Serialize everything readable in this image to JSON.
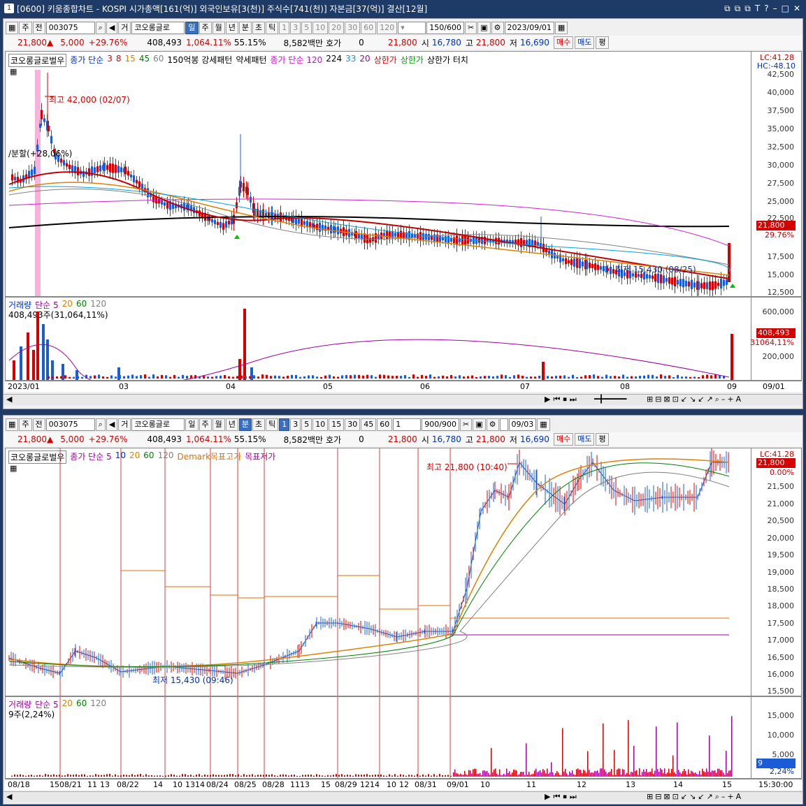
{
  "title": {
    "num": "1",
    "text": "[0600] 키움종합차트 - KOSPI 시가총액[161(억)] 외국인보유[3(천)] 주식수[741(천)] 자본금[37(억)] 결산[12월]",
    "ctrls": [
      "⧉",
      "⧉",
      "⧉",
      "T",
      "?",
      "–",
      "□",
      "✕"
    ]
  },
  "top": {
    "toolbar": {
      "kind": "주",
      "whole": "전",
      "code": "003075",
      "trade": "거",
      "name": "코오롱글로",
      "periods": [
        "일",
        "주",
        "월",
        "년",
        "분",
        "초",
        "틱"
      ],
      "nums": [
        "1",
        "3",
        "5",
        "10",
        "20",
        "30",
        "60",
        "120"
      ],
      "count": "150",
      "countmax": "/600",
      "date": "2023/09/01"
    },
    "info": {
      "price": "21,800",
      "arrow": "▲",
      "change": "5,000",
      "pct": "+29.76%",
      "volume": "408,493",
      "volpct": "1,064.11%",
      "ratio": "55.15%",
      "amount": "8,582백만",
      "hoga": "호가",
      "hogaval": "0",
      "cur": "21,800",
      "open_l": "시",
      "open": "16,780",
      "high_l": "고",
      "high": "21,800",
      "low_l": "저",
      "low": "16,690",
      "buy": "매수",
      "sell": "매도",
      "avg": "평"
    },
    "legend": [
      {
        "t": "코오롱글로벌우",
        "c": "#000"
      },
      {
        "t": "종가 단순",
        "c": "#0030c0"
      },
      {
        "t": "3",
        "c": "#e00000"
      },
      {
        "t": "8",
        "c": "#e00000"
      },
      {
        "t": "15",
        "c": "#e08000"
      },
      {
        "t": "45",
        "c": "#008000"
      },
      {
        "t": "60",
        "c": "#808080"
      },
      {
        "t": "150억봉 강세패턴",
        "c": "#000"
      },
      {
        "t": "약세패턴",
        "c": "#000"
      },
      {
        "t": "종가 단순 120",
        "c": "#e000e0"
      },
      {
        "t": "224",
        "c": "#000"
      },
      {
        "t": "33",
        "c": "#00a0e0"
      },
      {
        "t": "20",
        "c": "#a000a0"
      },
      {
        "t": "상한가",
        "c": "#e00000"
      },
      {
        "t": "상한가",
        "c": "#00a000"
      },
      {
        "t": "상한가 터치",
        "c": "#000"
      }
    ],
    "lc": "LC:41.28",
    "hc": "HC:-48.10",
    "yticks": [
      "42,500",
      "40,000",
      "37,500",
      "35,000",
      "32,500",
      "30,000",
      "27,500",
      "25,000",
      "22,500",
      "21,800",
      "29.76%",
      "17,500",
      "15,000",
      "12,500"
    ],
    "max_label": "최고 42,000 (02/07)",
    "min_label": "최저 15,430 (08/25)",
    "split_label": "/분할(+28,06%)",
    "vol_legend": [
      {
        "t": "거래량",
        "c": "#0030c0"
      },
      {
        "t": "단순 5",
        "c": "#a000a0"
      },
      {
        "t": "20",
        "c": "#e08000"
      },
      {
        "t": "60",
        "c": "#008000"
      },
      {
        "t": "120",
        "c": "#808080"
      }
    ],
    "vol_info": "408,493주(31,064,11%)",
    "vol_ticks": [
      "600,000",
      "408,493",
      "31064,11%",
      "200,000"
    ],
    "xlabels": [
      "2023/01",
      "03",
      "04",
      "05",
      "06",
      "07",
      "08",
      "09",
      "09/01"
    ]
  },
  "bottom": {
    "toolbar": {
      "kind": "주",
      "whole": "전",
      "code": "003075",
      "trade": "거",
      "name": "코오롱글로",
      "periods": [
        "일",
        "주",
        "월",
        "년",
        "분",
        "초",
        "틱"
      ],
      "nums": [
        "1",
        "3",
        "5",
        "10",
        "15",
        "30",
        "45",
        "60"
      ],
      "sel": "1",
      "count": "900",
      "countmax": "/900",
      "date": "09/03"
    },
    "info": {
      "price": "21,800",
      "arrow": "▲",
      "change": "5,000",
      "pct": "+29.76%",
      "volume": "408,493",
      "volpct": "1,064.11%",
      "ratio": "55.15%",
      "amount": "8,582백만",
      "hoga": "호가",
      "hogaval": "0",
      "cur": "21,800",
      "open_l": "시",
      "open": "16,780",
      "high_l": "고",
      "high": "21,800",
      "low_l": "저",
      "low": "16,690",
      "buy": "매수",
      "sell": "매도",
      "avg": "평"
    },
    "legend": [
      {
        "t": "코오롱글로벌우",
        "c": "#000"
      },
      {
        "t": "종가 단순 5",
        "c": "#a000a0"
      },
      {
        "t": "10",
        "c": "#0030c0"
      },
      {
        "t": "20",
        "c": "#e08000"
      },
      {
        "t": "60",
        "c": "#008000"
      },
      {
        "t": "120",
        "c": "#808080"
      },
      {
        "t": "Demark목표고가",
        "c": "#e07000"
      },
      {
        "t": "목표저가",
        "c": "#a000a0"
      }
    ],
    "lc": "LC:41.28",
    "hc": "21,800",
    "yticks": [
      "0.00%",
      "21,500",
      "21,000",
      "20,500",
      "20,000",
      "19,500",
      "19,000",
      "18,500",
      "18,000",
      "17,500",
      "17,000",
      "16,500",
      "16,000",
      "15,500"
    ],
    "max_label": "최고 21,800 (10:40)",
    "min_label": "최저 15,430 (09:46)",
    "vol_legend": [
      {
        "t": "거래량",
        "c": "#a000a0"
      },
      {
        "t": "단순 5",
        "c": "#a000a0"
      },
      {
        "t": "20",
        "c": "#e08000"
      },
      {
        "t": "60",
        "c": "#008000"
      },
      {
        "t": "120",
        "c": "#808080"
      }
    ],
    "vol_info": "9주(2,24%)",
    "vol_ticks": [
      "15,000",
      "10,000",
      "5,000",
      "9",
      "2,24%"
    ],
    "xlabels": [
      "08/18",
      "15",
      "08/21",
      "11",
      "13",
      "08/22",
      "14",
      "10",
      "13",
      "14",
      "08/24",
      "08/25",
      "08/28",
      "11",
      "13",
      "15",
      "08/29",
      "12",
      "14",
      "10",
      "12",
      "08/31",
      "09/01",
      "10",
      "11",
      "12",
      "13",
      "14",
      "15",
      "15:30:00"
    ]
  }
}
